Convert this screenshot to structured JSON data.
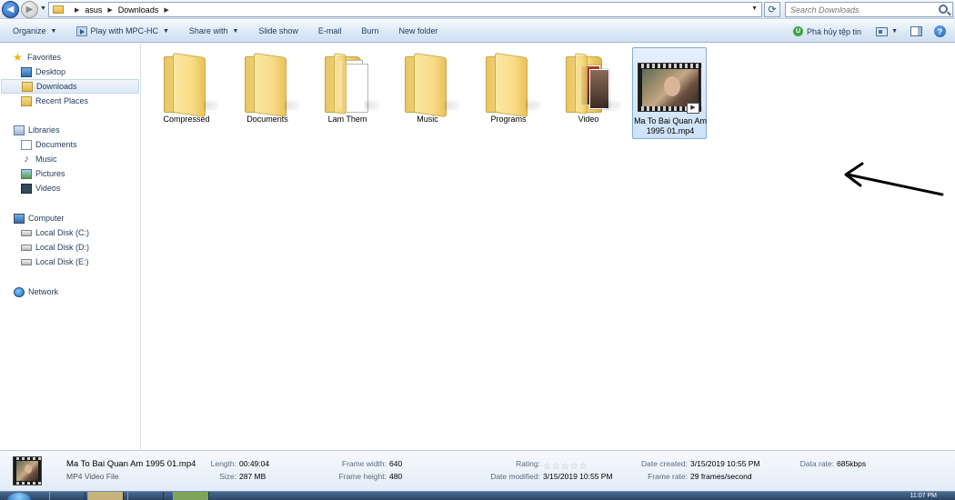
{
  "address": {
    "crumbs": [
      "asus",
      "Downloads"
    ],
    "search_placeholder": "Search Downloads"
  },
  "toolbar": {
    "organize": "Organize",
    "play_with": "Play with MPC-HC",
    "share_with": "Share with",
    "slide_show": "Slide show",
    "email": "E-mail",
    "burn": "Burn",
    "new_folder": "New folder",
    "unikey": "Phá hủy tệp tin"
  },
  "nav": {
    "favorites": "Favorites",
    "desktop": "Desktop",
    "downloads": "Downloads",
    "recent": "Recent Places",
    "libraries": "Libraries",
    "documents": "Documents",
    "music": "Music",
    "pictures": "Pictures",
    "videos": "Videos",
    "computer": "Computer",
    "disk_c": "Local Disk (C:)",
    "disk_d": "Local Disk (D:)",
    "disk_e": "Local Disk (E:)",
    "network": "Network"
  },
  "files": [
    {
      "name": "Compressed",
      "kind": "folder"
    },
    {
      "name": "Documents",
      "kind": "folder"
    },
    {
      "name": "Lam Them",
      "kind": "folder-docs"
    },
    {
      "name": "Music",
      "kind": "folder"
    },
    {
      "name": "Programs",
      "kind": "folder"
    },
    {
      "name": "Video",
      "kind": "folder-photos"
    },
    {
      "name": "Ma To Bai Quan Am 1995 01.mp4",
      "kind": "video"
    }
  ],
  "details": {
    "name": "Ma To Bai Quan Am 1995 01.mp4",
    "type": "MP4 Video File",
    "length_label": "Length:",
    "length": "00:49:04",
    "size_label": "Size:",
    "size": "287 MB",
    "frame_width_label": "Frame width:",
    "frame_width": "640",
    "frame_height_label": "Frame height:",
    "frame_height": "480",
    "rating_label": "Rating:",
    "rating": 0,
    "date_modified_label": "Date modified:",
    "date_modified": "3/15/2019 10:55 PM",
    "date_created_label": "Date created:",
    "date_created": "3/15/2019 10:55 PM",
    "frame_rate_label": "Frame rate:",
    "frame_rate": "29 frames/second",
    "data_rate_label": "Data rate:",
    "data_rate": "685kbps"
  },
  "taskbar": {
    "clock": "11:07 PM"
  }
}
